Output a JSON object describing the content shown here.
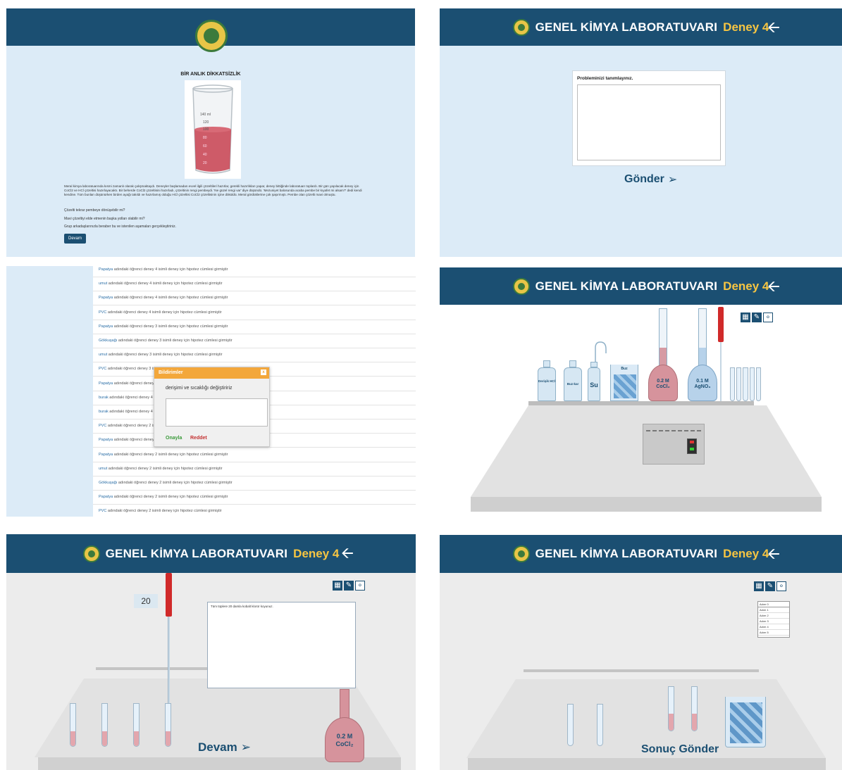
{
  "panel1": {
    "heading": "BİR ANLIK DİKKATSİZLİK",
    "beaker_marks": [
      "140 ml",
      "120",
      "100",
      "80",
      "60",
      "40",
      "20"
    ],
    "story": "Meral kimya laboratuarında kısmi zamanlı olarak çalışmaktaydı. Deneyler başlamadan evvel ilgili çözeltileri hazırlar, gerekli hazırlıkları yapar, deney bittiğinde laboratuarı toplardı. Bir gün yapılacak deney için CoCl2 ve HCl çözeltisi hazırlayacaktı. Bir beherde CoCl2 çözeltisini hazırladı, çözeltinin rengi pembeydi. 'Ne güzel rengi var' diye düşündü. 'Mezuniyet balosunda acaba pembe bir kıyafet mi alsam?' dedi kendi kendine. Tüm bunları düşünürken birden ayağı takıldı ve hazırlamış olduğu HCl çözeltisi CoCl2 çözeltisinin içine döküldü. Meral gördüklerine çok şaşırmıştı. Pembe olan çözelti mavi olmuştu.",
    "q1": "Çözelti tekrar pembeye dönüşebilir mi?",
    "q2": "Mavi çözeltiyi elde etmenin başka yolları olabilir mi?",
    "q3": "Grup arkadaşlarınızla beraber bu ve istenilen aşamaları gerçekleştiriniz.",
    "continue_btn": "Devam"
  },
  "header": {
    "title": "GENEL KİMYA LABORATUVARI",
    "experiment": "Deney 4"
  },
  "panel2": {
    "prompt": "Probleminizi tanımlayınız.",
    "textarea_value": "",
    "submit_btn": "Gönder"
  },
  "panel3": {
    "rows": [
      {
        "user": "Papatya",
        "text": "adındaki öğrenci deney 4 isimli deney için hipotez cümlesi girmiştir"
      },
      {
        "user": "umut",
        "text": "adındaki öğrenci deney 4 isimli deney için hipotez cümlesi girmiştir"
      },
      {
        "user": "Papatya",
        "text": "adındaki öğrenci deney 4 isimli deney için hipotez cümlesi girmiştir"
      },
      {
        "user": "PVC",
        "text": "adındaki öğrenci deney 4 isimli deney için hipotez cümlesi girmiştir"
      },
      {
        "user": "Papatya",
        "text": "adındaki öğrenci deney 3 isimli deney için hipotez cümlesi girmiştir"
      },
      {
        "user": "Gökkuşağı",
        "text": "adındaki öğrenci deney 3 isimli deney için hipotez cümlesi girmiştir"
      },
      {
        "user": "umut",
        "text": "adındaki öğrenci deney 3 isimli deney için hipotez cümlesi girmiştir"
      },
      {
        "user": "PVC",
        "text": "adındaki öğrenci deney 3 is"
      },
      {
        "user": "Papatya",
        "text": "adındaki öğrenci deney"
      },
      {
        "user": "burak",
        "text": "adındaki öğrenci deney 4"
      },
      {
        "user": "burak",
        "text": "adındaki öğrenci deney 4"
      },
      {
        "user": "PVC",
        "text": "adındaki öğrenci deney 2 is"
      },
      {
        "user": "Papatya",
        "text": "adındaki öğrenci deney"
      },
      {
        "user": "Papatya",
        "text": "adındaki öğrenci deney 2 isimli deney için hipotez cümlesi girmiştir"
      },
      {
        "user": "umut",
        "text": "adındaki öğrenci deney 2 isimli deney için hipotez cümlesi girmiştir"
      },
      {
        "user": "Gökkuşağı",
        "text": "adındaki öğrenci deney 2 isimli deney için hipotez cümlesi girmiştir"
      },
      {
        "user": "Papatya",
        "text": "adındaki öğrenci deney 2 isimli deney için hipotez cümlesi girmiştir"
      },
      {
        "user": "PVC",
        "text": "adındaki öğrenci deney 2 isimli deney için hipotez cümlesi girmiştir"
      }
    ],
    "modal": {
      "title": "Bildirimler",
      "close": "x",
      "message": "derişimi ve sıcaklığı değiştiririz",
      "approve": "Onayla",
      "reject": "Reddet"
    }
  },
  "panel4": {
    "bottles": [
      "Derişik HCl",
      "Buz-kar",
      "Su"
    ],
    "ice_label": "Buz",
    "flask1": "0.2 M CoCl₂",
    "flask2": "0.1 M AgNO₃"
  },
  "panel5": {
    "volume": "20",
    "note": "Tüm tüplere 20 damla kobalt klorür koyunuz.",
    "flask": "0.2 M CoCl₂",
    "continue_btn": "Devam"
  },
  "panel6": {
    "select_items": [
      "Adım 0",
      "Adım 1",
      "Adım 2",
      "Adım 3",
      "Adım 4",
      "Adım 5"
    ],
    "submit_btn": "Sonuç Gönder"
  }
}
